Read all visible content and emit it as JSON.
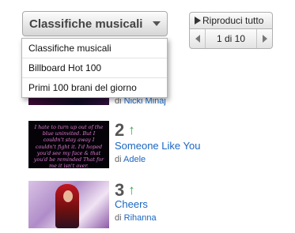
{
  "dropdown": {
    "selected": "Classifiche musicali",
    "options": [
      "Classifiche musicali",
      "Billboard Hot 100",
      "Primi 100 brani del giorno"
    ]
  },
  "controls": {
    "play_all_label": "Riproduci tutto",
    "page_label": "1 di 10"
  },
  "by_label": "di",
  "entries": [
    {
      "artist": "Nicki Minaj"
    },
    {
      "rank": "2",
      "trend": "↑",
      "title": "Someone Like You",
      "artist": "Adele",
      "thumbnail_lyrics": "I hate to turn up out of the blue uninvited. But I couldn't stay away I couldn't fight it. I'd hoped you'd see my face & that you'd be reminded That for me it isn't over."
    },
    {
      "rank": "3",
      "trend": "↑",
      "title": "Cheers",
      "artist": "Rihanna"
    }
  ],
  "colors": {
    "link": "#1a66c2",
    "trend_up": "#3aa84a",
    "lyrics": "#e07ad4"
  }
}
